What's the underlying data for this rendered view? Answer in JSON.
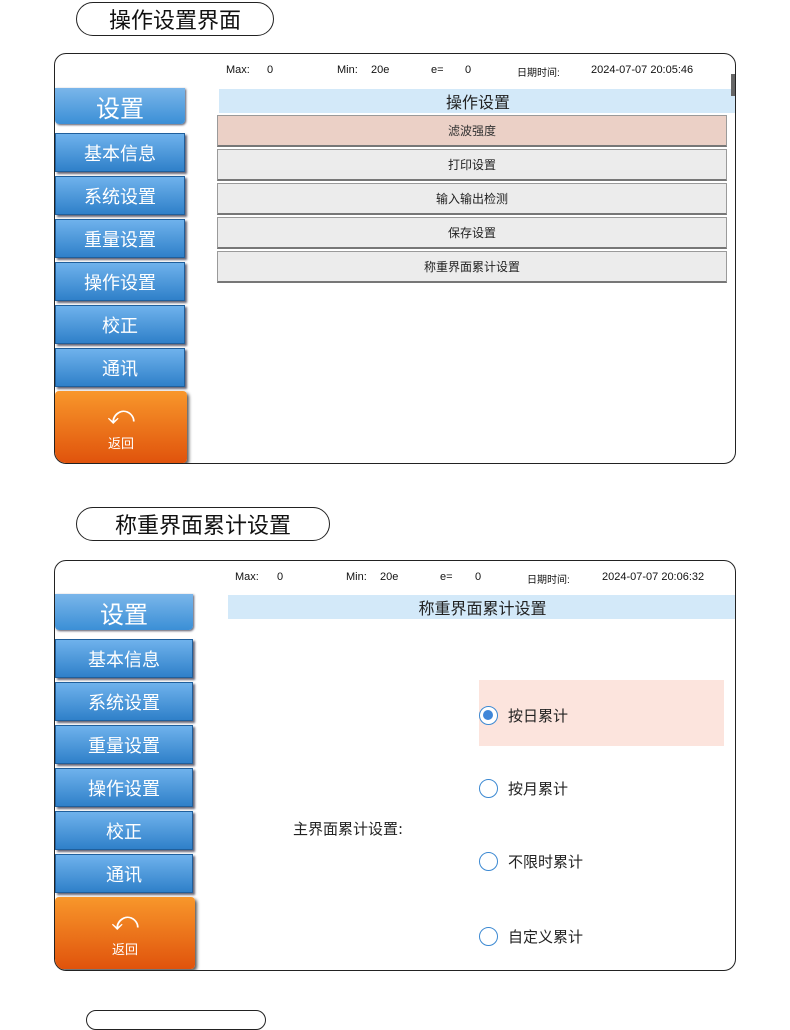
{
  "section1": {
    "title": "操作设置界面",
    "status": {
      "max_label": "Max:",
      "max_value": "0",
      "min_label": "Min:",
      "min_value": "20e",
      "e_label": "e=",
      "e_value": "0",
      "datetime_label": "日期时间:",
      "datetime_value": "2024-07-07 20:05:46"
    },
    "sidebar": {
      "title": "设置",
      "items": [
        "基本信息",
        "系统设置",
        "重量设置",
        "操作设置",
        "校正",
        "通讯"
      ],
      "back_label": "返回"
    },
    "header": "操作设置",
    "menu": [
      "滤波强度",
      "打印设置",
      "输入输出检测",
      "保存设置",
      "称重界面累计设置"
    ],
    "active_menu": "滤波强度"
  },
  "section2": {
    "title": "称重界面累计设置",
    "status": {
      "max_label": "Max:",
      "max_value": "0",
      "min_label": "Min:",
      "min_value": "20e",
      "e_label": "e=",
      "e_value": "0",
      "datetime_label": "日期时间:",
      "datetime_value": "2024-07-07 20:06:32"
    },
    "sidebar": {
      "title": "设置",
      "items": [
        "基本信息",
        "系统设置",
        "重量设置",
        "操作设置",
        "校正",
        "通讯"
      ],
      "back_label": "返回"
    },
    "header": "称重界面累计设置",
    "field_label": "主界面累计设置:",
    "options": [
      "按日累计",
      "按月累计",
      "不限时累计",
      "自定义累计"
    ],
    "selected_option": "按日累计"
  },
  "colors": {
    "sidebar_blue": "#3b8fd6",
    "back_orange": "#e0530c",
    "header_bg": "#d3e9f9",
    "active_menu_bg": "#ebd0c6",
    "radio_highlight": "#fce4dd"
  }
}
